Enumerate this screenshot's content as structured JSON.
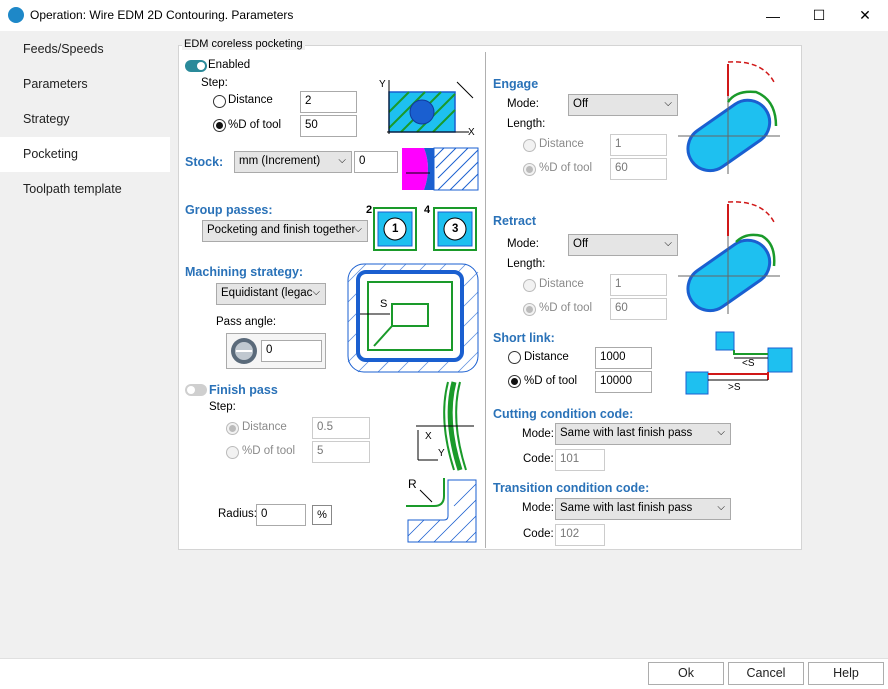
{
  "window": {
    "title": "Operation: Wire EDM 2D Contouring. Parameters",
    "minimize": "—",
    "maximize": "☐",
    "close": "✕"
  },
  "sidebar": {
    "items": [
      {
        "label": "Feeds/Speeds"
      },
      {
        "label": "Parameters"
      },
      {
        "label": "Strategy"
      },
      {
        "label": "Pocketing"
      },
      {
        "label": "Toolpath template"
      }
    ],
    "active": "Pocketing"
  },
  "group_title": "EDM coreless pocketing",
  "left": {
    "enabled_label": "Enabled",
    "enabled": true,
    "step_label": "Step:",
    "distance_label": "Distance",
    "distance_value": "2",
    "pct_label": "%D of tool",
    "pct_value": "50",
    "stock_label": "Stock:",
    "stock_select": "mm (Increment)",
    "stock_value": "0",
    "group_passes_label": "Group passes:",
    "group_passes_select": "Pocketing and finish together",
    "group_icon_num1": "2",
    "group_icon_num2": "4",
    "group_icon_in1": "1",
    "group_icon_in2": "3",
    "machining_label": "Machining strategy:",
    "machining_select": "Equidistant (legac",
    "pass_angle_label": "Pass angle:",
    "pass_angle_value": "0",
    "finish_label": "Finish pass",
    "finish_enabled": false,
    "finish_step_label": "Step:",
    "finish_distance_label": "Distance",
    "finish_distance_value": "0.5",
    "finish_pct_label": "%D of tool",
    "finish_pct_value": "5",
    "radius_label": "Radius:",
    "radius_value": "0",
    "radius_pct_button": "%",
    "diagram_axis_x": "X",
    "diagram_axis_y": "Y",
    "diagram_s": "S",
    "diagram_r": "R"
  },
  "right": {
    "engage": {
      "title": "Engage",
      "mode_label": "Mode:",
      "mode_value": "Off",
      "length_label": "Length:",
      "distance_label": "Distance",
      "distance_value": "1",
      "pct_label": "%D of tool",
      "pct_value": "60"
    },
    "retract": {
      "title": "Retract",
      "mode_label": "Mode:",
      "mode_value": "Off",
      "length_label": "Length:",
      "distance_label": "Distance",
      "distance_value": "1",
      "pct_label": "%D of tool",
      "pct_value": "60"
    },
    "short_link": {
      "title": "Short link:",
      "distance_label": "Distance",
      "distance_value": "1000",
      "pct_label": "%D of tool",
      "pct_value": "10000",
      "lt_s": "<S",
      "gt_s": ">S"
    },
    "cutting": {
      "title": "Cutting condition code:",
      "mode_label": "Mode:",
      "mode_value": "Same with last finish pass",
      "code_label": "Code:",
      "code_value": "101"
    },
    "transition": {
      "title": "Transition condition code:",
      "mode_label": "Mode:",
      "mode_value": "Same with last finish pass",
      "code_label": "Code:",
      "code_value": "102"
    }
  },
  "buttons": {
    "ok": "Ok",
    "cancel": "Cancel",
    "help": "Help"
  },
  "colors": {
    "section_title": "#2a72b8",
    "diagram_blue": "#1a5fd0",
    "diagram_cyan": "#1ec0f0",
    "diagram_green": "#1a9a2a",
    "diagram_red": "#d01818",
    "diagram_magenta": "#ff00ff"
  }
}
